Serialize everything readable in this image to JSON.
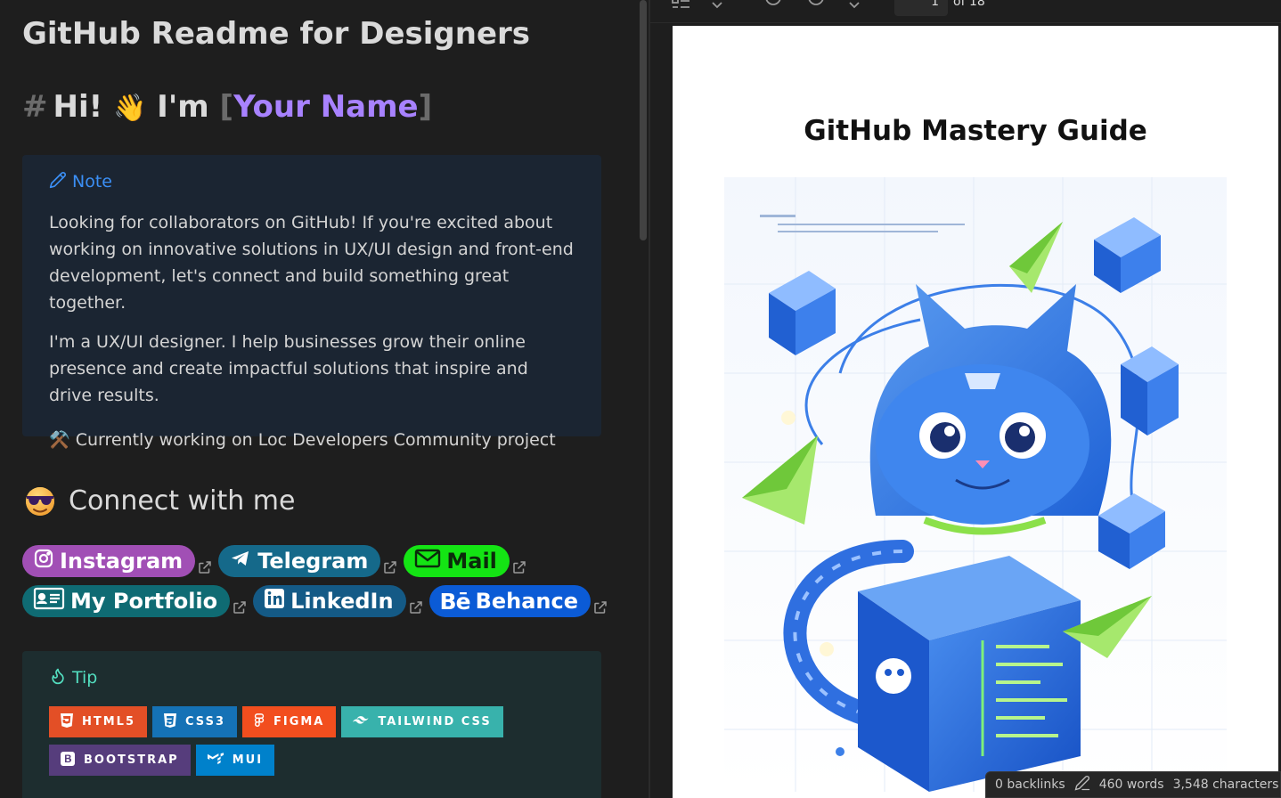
{
  "editor": {
    "title": "GitHub Readme for Designers",
    "heading": {
      "hash": "#",
      "greeting": "Hi!",
      "wave": "👋",
      "im": "I'm",
      "bracket_open": "[",
      "name": "Your Name",
      "bracket_close": "]"
    },
    "note": {
      "label": "Note",
      "para1": "Looking for collaborators on GitHub! If you're excited about working on innovative solutions in UX/UI design and front-end development, let's connect and build something great together.",
      "para2": "I'm a UX/UI designer. I help businesses grow their online presence and create impactful solutions that inspire and drive results.",
      "para3": "⚒️ Currently working on Loc Developers Community project"
    },
    "connect_heading": "Connect with me",
    "badges_row1": [
      {
        "label": "Instagram",
        "icon": "instagram-icon",
        "color": "#a14fb5"
      },
      {
        "label": "Telegram",
        "icon": "telegram-icon",
        "color": "#15698a"
      },
      {
        "label": "Mail",
        "icon": "mail-icon",
        "color": "#14e414"
      }
    ],
    "badges_row2": [
      {
        "label": "My Portfolio",
        "icon": "id-card-icon",
        "color": "#0f6b73"
      },
      {
        "label": "LinkedIn",
        "icon": "linkedin-icon",
        "color": "#145a86"
      },
      {
        "label": "Behance",
        "icon": "behance-icon",
        "color": "#0b5bd6"
      }
    ],
    "tip": {
      "label": "Tip",
      "shields_row1": [
        {
          "label": "HTML5",
          "icon": "html5-icon",
          "color": "#e34f26"
        },
        {
          "label": "CSS3",
          "icon": "css3-icon",
          "color": "#1572b6"
        },
        {
          "label": "FIGMA",
          "icon": "figma-icon",
          "color": "#f24e1e"
        },
        {
          "label": "TAILWIND CSS",
          "icon": "tailwind-icon",
          "color": "#38b2ac"
        }
      ],
      "shields_row2": [
        {
          "label": "BOOTSTRAP",
          "icon": "bootstrap-icon",
          "color": "#563d7c"
        },
        {
          "label": "MUI",
          "icon": "mui-icon",
          "color": "#0081cb"
        }
      ]
    }
  },
  "pdf": {
    "toolbar": {
      "page_number": "1",
      "page_of": "of 18"
    },
    "page": {
      "title": "GitHub Mastery Guide"
    }
  },
  "status_bar": {
    "backlinks": "0 backlinks",
    "words": "460 words",
    "characters": "3,548 characters"
  },
  "colors": {
    "accent_purple": "#a882ff",
    "note_blue": "#3b8ff5",
    "tip_teal": "#53dfc0"
  }
}
